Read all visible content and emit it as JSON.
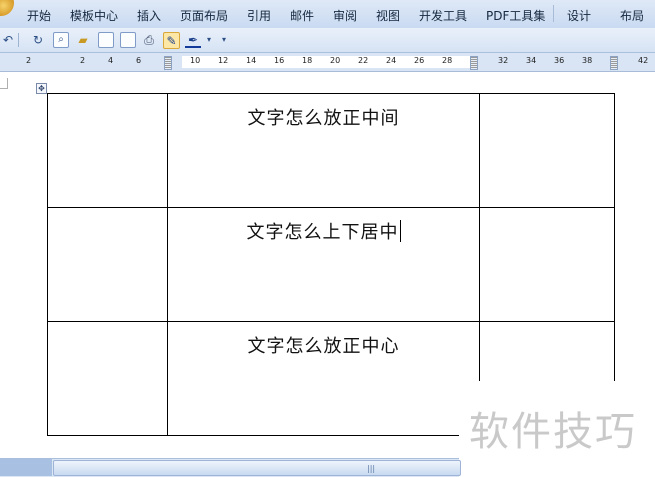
{
  "ribbon": {
    "tabs": [
      "开始",
      "模板中心",
      "插入",
      "页面布局",
      "引用",
      "邮件",
      "审阅",
      "视图",
      "开发工具",
      "PDF工具集",
      "设计",
      "布局"
    ]
  },
  "quick_access": {
    "icons": [
      "undo-icon",
      "redo-icon",
      "print-preview-icon",
      "open-folder-icon",
      "page-icon",
      "new-document-icon",
      "print-icon",
      "draw-table-icon",
      "pen-color-icon",
      "customize-dropdown-icon"
    ]
  },
  "ruler": {
    "labels": [
      "2",
      "2",
      "4",
      "6",
      "10",
      "12",
      "14",
      "16",
      "18",
      "20",
      "22",
      "24",
      "26",
      "28",
      "32",
      "34",
      "36",
      "38",
      "42"
    ]
  },
  "table": {
    "rows": [
      {
        "cells": [
          "",
          "文字怎么放正中间",
          ""
        ]
      },
      {
        "cells": [
          "",
          "文字怎么上下居中",
          ""
        ]
      },
      {
        "cells": [
          "",
          "文字怎么放正中心",
          ""
        ]
      }
    ]
  },
  "watermark": {
    "text": "软件技巧"
  },
  "scrollbar": {
    "grip": "|||"
  }
}
